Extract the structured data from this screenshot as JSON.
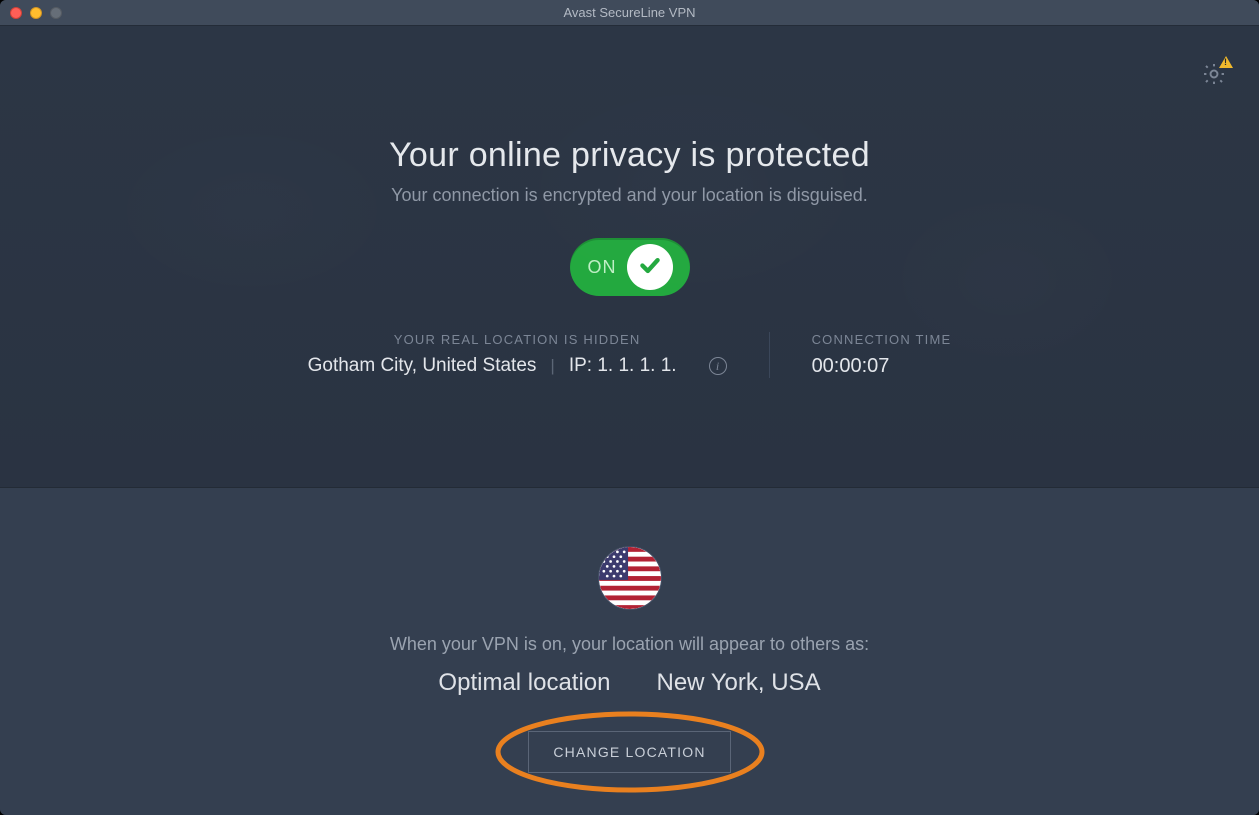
{
  "window": {
    "title": "Avast SecureLine VPN"
  },
  "settings": {
    "has_warning": true
  },
  "status": {
    "headline": "Your online privacy is protected",
    "subheadline": "Your connection is encrypted and your location is disguised.",
    "toggle_label": "ON",
    "toggle_on": true
  },
  "real_location": {
    "section_label": "YOUR REAL LOCATION IS HIDDEN",
    "city_country": "Gotham City, United States",
    "ip_label": "IP: 1. 1. 1. 1."
  },
  "connection": {
    "section_label": "CONNECTION TIME",
    "value": "00:00:07"
  },
  "apparent": {
    "caption": "When your VPN is on, your location will appear to others as:",
    "mode": "Optimal location",
    "location": "New York, USA",
    "flag_country": "US"
  },
  "buttons": {
    "change_location": "CHANGE LOCATION"
  },
  "colors": {
    "toggle_green": "#23a93f",
    "highlight_orange": "#e9801f"
  }
}
